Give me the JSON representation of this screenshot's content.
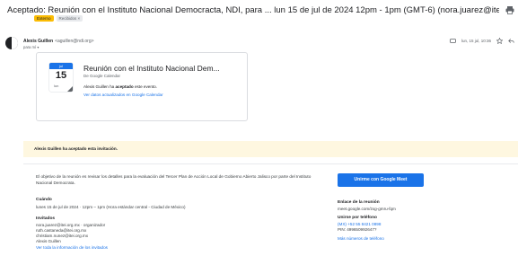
{
  "email": {
    "subject": "Aceptado: Reunión con el Instituto Nacional Democracta, NDI, para ... lun 15 de jul de 2024 12pm - 1pm (GMT-6) (nora.juarez@itei.org.mx)",
    "labels": [
      "Externo",
      "Recibidos ×"
    ],
    "sender_name": "Alexis Guillen",
    "sender_email": "<aguillen@ndi.org>",
    "to_line": "para mí ▾",
    "date": "lun, 15 jul, 10:36"
  },
  "card": {
    "month": "jul",
    "day": "15",
    "weekday": "lun",
    "title": "Reunión con el Instituto Nacional Dem...",
    "source": "De Google Calendar",
    "line_prefix": "Alexis Guillen ha ",
    "line_bold": "aceptado",
    "line_suffix": " este evento.",
    "link": "Ver datos actualizados en Google Calendar"
  },
  "banner": {
    "text": "Alexis Guillen ha aceptado esta invitación."
  },
  "invite": {
    "description": "El objetivo de la reunión es revisar los detalles para la evaluación del Tercer Plan de Acción Local de Gobierno Abierto Jalisco por parte del Instituto Nacional Democrata.",
    "when_title": "Cuándo",
    "when_text": "lunes 15 de jul de 2024 · 12pm – 1pm (Hora estándar central - Ciudad de México)",
    "guests_title": "Invitados",
    "guests": [
      "nora.juarez@itei.org.mx · organizador",
      "ruth.castaneda@itei.org.mx",
      "christiam.nunez@itei.org.mx",
      "Alexis Guillen"
    ],
    "guests_link": "Ver toda la información de los invitados",
    "meet_button": "Unirme con Google Meet",
    "meet_link_title": "Enlace de la reunión",
    "meet_link": "meet.google.com/zxg-gmru-fqm",
    "phone_title": "Unirse por teléfono",
    "phone_number": "(MX) +52 55 8421 0898",
    "pin": "PIN: 499650992647?",
    "more_phones": "Más números de teléfono"
  },
  "colors": {
    "accent": "#1a73e8",
    "banner_bg": "#fef7e0",
    "external_label": "#fbbc04"
  }
}
